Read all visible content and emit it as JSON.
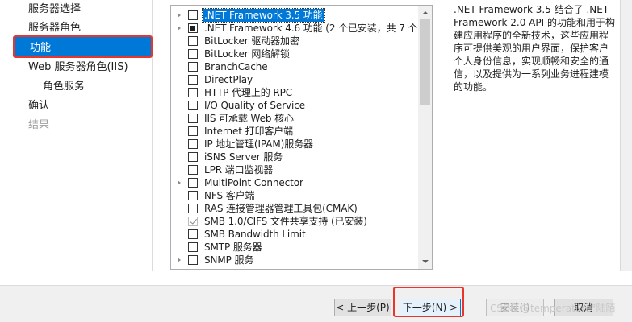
{
  "nav": {
    "items": [
      {
        "label": "服务器选择",
        "state": "normal"
      },
      {
        "label": "服务器角色",
        "state": "normal"
      },
      {
        "label": "功能",
        "state": "selected"
      },
      {
        "label": "Web 服务器角色(IIS)",
        "state": "normal"
      },
      {
        "label": "角色服务",
        "state": "sub"
      },
      {
        "label": "确认",
        "state": "normal"
      },
      {
        "label": "结果",
        "state": "disabled"
      }
    ]
  },
  "features": [
    {
      "label": ".NET Framework 3.5 功能",
      "expandable": true,
      "check": "none",
      "highlight": true
    },
    {
      "label": ".NET Framework 4.6 功能 (2 个已安装，共 7 个)",
      "expandable": true,
      "check": "partial"
    },
    {
      "label": "BitLocker 驱动器加密",
      "expandable": false,
      "check": "none"
    },
    {
      "label": "BitLocker 网络解锁",
      "expandable": false,
      "check": "none"
    },
    {
      "label": "BranchCache",
      "expandable": false,
      "check": "none"
    },
    {
      "label": "DirectPlay",
      "expandable": false,
      "check": "none"
    },
    {
      "label": "HTTP 代理上的 RPC",
      "expandable": false,
      "check": "none"
    },
    {
      "label": "I/O Quality of Service",
      "expandable": false,
      "check": "none"
    },
    {
      "label": "IIS 可承载 Web 核心",
      "expandable": false,
      "check": "none"
    },
    {
      "label": "Internet 打印客户端",
      "expandable": false,
      "check": "none"
    },
    {
      "label": "IP 地址管理(IPAM)服务器",
      "expandable": false,
      "check": "none"
    },
    {
      "label": "iSNS Server 服务",
      "expandable": false,
      "check": "none"
    },
    {
      "label": "LPR 端口监视器",
      "expandable": false,
      "check": "none"
    },
    {
      "label": "MultiPoint Connector",
      "expandable": true,
      "check": "none"
    },
    {
      "label": "NFS 客户端",
      "expandable": false,
      "check": "none"
    },
    {
      "label": "RAS 连接管理器管理工具包(CMAK)",
      "expandable": false,
      "check": "none"
    },
    {
      "label": "SMB 1.0/CIFS 文件共享支持 (已安装)",
      "expandable": false,
      "check": "checked-disabled"
    },
    {
      "label": "SMB Bandwidth Limit",
      "expandable": false,
      "check": "none"
    },
    {
      "label": "SMTP 服务器",
      "expandable": false,
      "check": "none"
    },
    {
      "label": "SNMP 服务",
      "expandable": true,
      "check": "none"
    }
  ],
  "description": ".NET Framework 3.5 结合了 .NET Framework 2.0 API 的功能和用于构建应用程序的全新技术，这些应用程序可提供美观的用户界面，保护客户个人身份信息，实现顺畅和安全的通信，以及提供为一系列业务进程建模的功能。",
  "buttons": {
    "previous": "< 上一步(P)",
    "next": "下一步(N) >",
    "install": "安装(I)",
    "cancel": "取消"
  },
  "watermark": "CSDN @temperature°陆陌",
  "colors": {
    "accent": "#0078d7",
    "annotation_red": "#e8362c"
  }
}
